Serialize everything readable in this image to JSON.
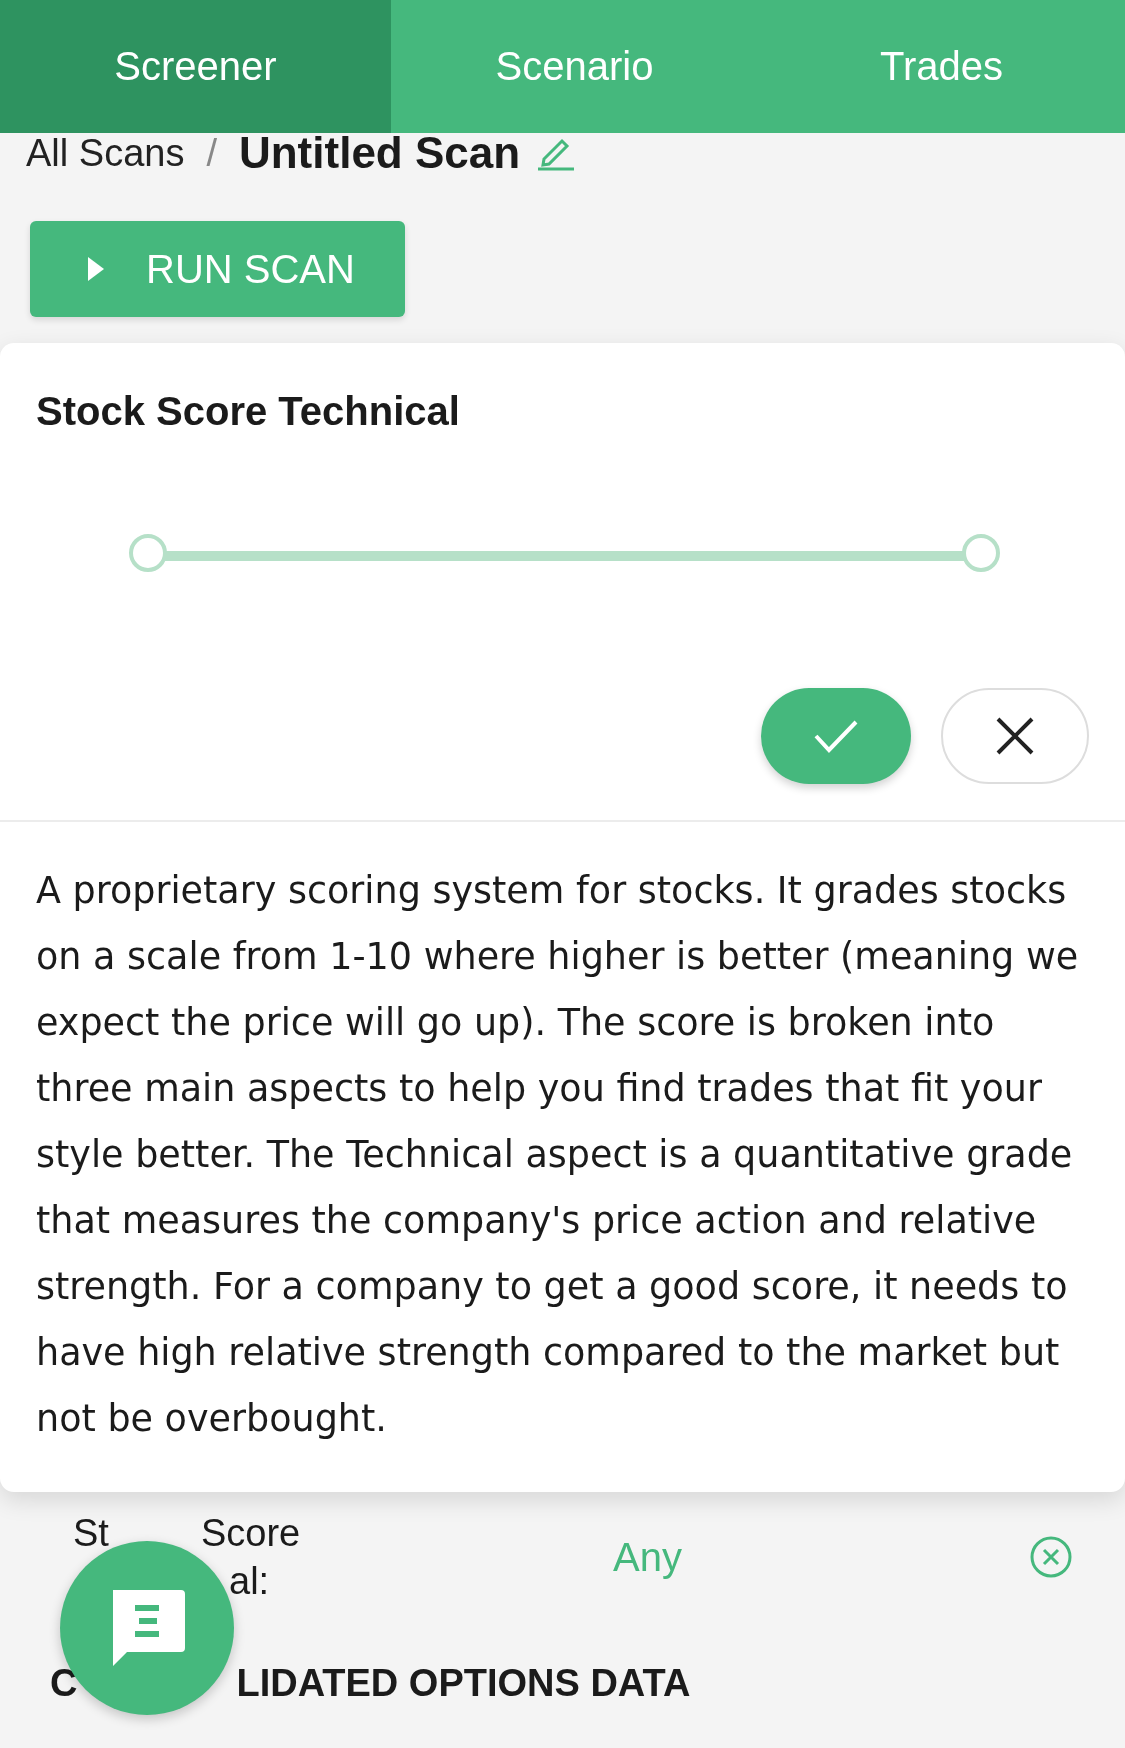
{
  "tabs": [
    {
      "label": "Screener",
      "selected": true
    },
    {
      "label": "Scenario",
      "selected": false
    },
    {
      "label": "Trades",
      "selected": false
    }
  ],
  "breadcrumb": {
    "parent": "All Scans",
    "separator": "/",
    "current": "Untitled Scan"
  },
  "run_button": {
    "label": "RUN SCAN"
  },
  "popover": {
    "title": "Stock Score Technical",
    "slider": {
      "handles": [
        {
          "level": 0
        },
        {
          "level": 1
        }
      ]
    },
    "description": "A proprietary scoring system for stocks. It grades stocks on a scale from 1-10 where higher is better (meaning we expect the price will go up). The score is broken into three main aspects to help you find trades that fit your style better. The Technical aspect is a quantitative grade that measures the company's price action and relative strength. For a company to get a good score, it needs to have high relative strength compared to the market but not be overbought."
  },
  "filter_row": {
    "label_lines": [
      [
        "St",
        "Score"
      ],
      [
        "al:"
      ]
    ],
    "value": "Any"
  },
  "section_heading": [
    "C",
    "LIDATED OPTIONS DATA"
  ]
}
